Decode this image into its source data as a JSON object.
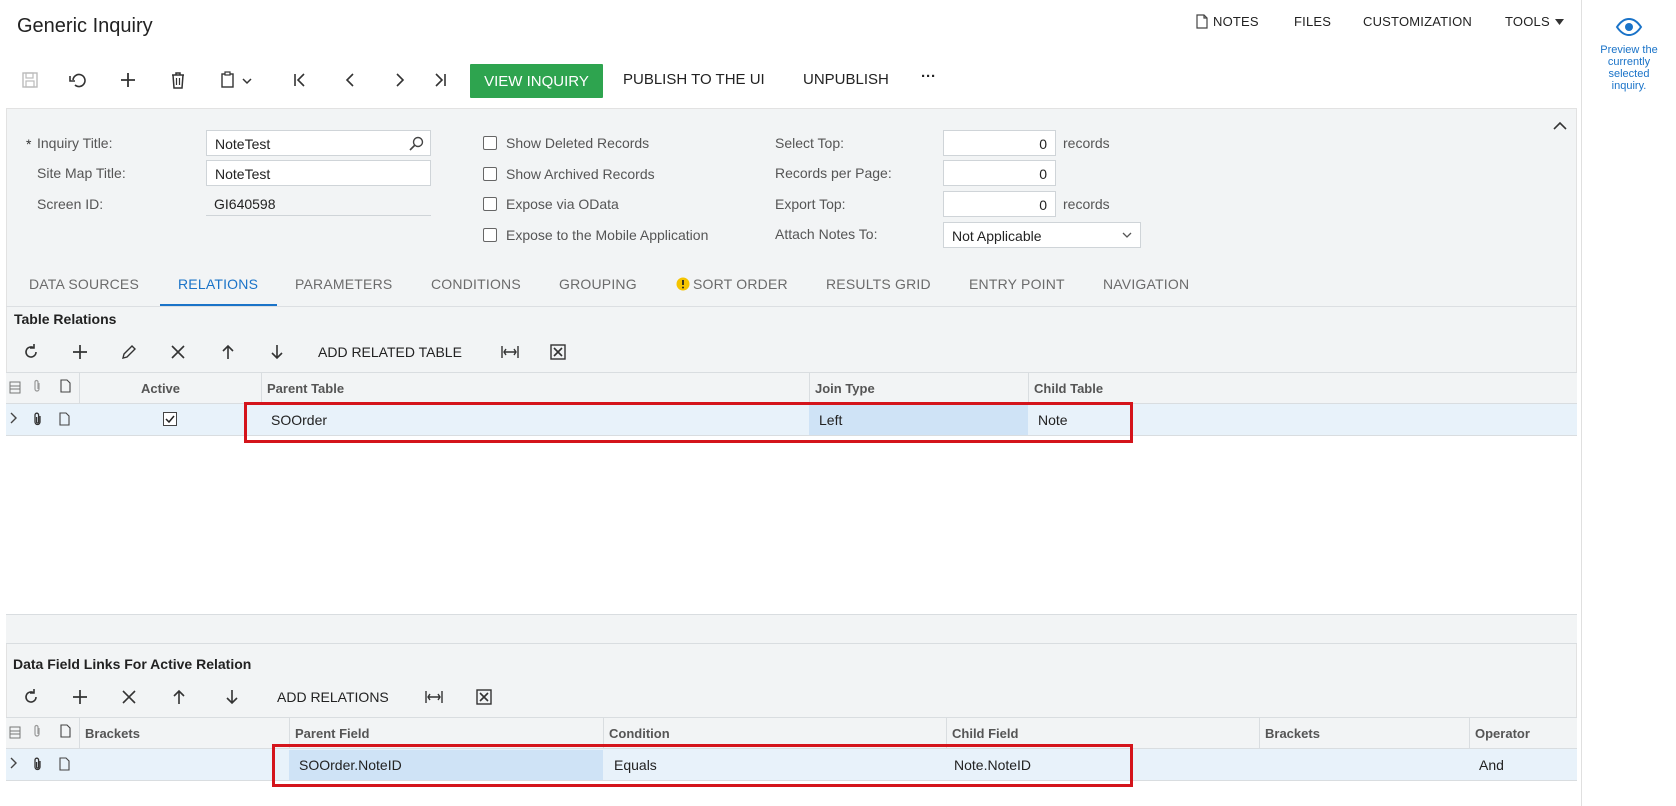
{
  "page": {
    "title": "Generic Inquiry"
  },
  "topmenu": {
    "notes": "NOTES",
    "files": "FILES",
    "customization": "CUSTOMIZATION",
    "tools": "TOOLS"
  },
  "toolbar": {
    "view_inquiry": "VIEW INQUIRY",
    "publish": "PUBLISH TO THE UI",
    "unpublish": "UNPUBLISH",
    "more": "···"
  },
  "right_panel": {
    "preview_text": "Preview the currently selected inquiry."
  },
  "form": {
    "required_marker": "*",
    "inquiry_title_label": "Inquiry Title:",
    "inquiry_title_value": "NoteTest",
    "site_map_title_label": "Site Map Title:",
    "site_map_title_value": "NoteTest",
    "screen_id_label": "Screen ID:",
    "screen_id_value": "GI640598",
    "show_deleted": "Show Deleted Records",
    "show_archived": "Show Archived Records",
    "expose_odata": "Expose via OData",
    "expose_mobile": "Expose to the Mobile Application",
    "select_top_label": "Select Top:",
    "select_top_value": "0",
    "records_per_page_label": "Records per Page:",
    "records_per_page_value": "0",
    "export_top_label": "Export Top:",
    "export_top_value": "0",
    "records_unit": "records",
    "attach_notes_label": "Attach Notes To:",
    "attach_notes_value": "Not Applicable"
  },
  "tabs": [
    {
      "label": "DATA SOURCES"
    },
    {
      "label": "RELATIONS",
      "active": true
    },
    {
      "label": "PARAMETERS"
    },
    {
      "label": "CONDITIONS"
    },
    {
      "label": "GROUPING"
    },
    {
      "label": "SORT ORDER",
      "warning": true
    },
    {
      "label": "RESULTS GRID"
    },
    {
      "label": "ENTRY POINT"
    },
    {
      "label": "NAVIGATION"
    }
  ],
  "table_relations": {
    "title": "Table Relations",
    "add_button": "ADD RELATED TABLE",
    "columns": [
      "Active",
      "Parent Table",
      "Join Type",
      "Child Table"
    ],
    "rows": [
      {
        "active": true,
        "parent_table": "SOOrder",
        "join_type": "Left",
        "child_table": "Note"
      }
    ]
  },
  "data_field_links": {
    "title": "Data Field Links For Active Relation",
    "add_button": "ADD RELATIONS",
    "columns": [
      "Brackets",
      "Parent Field",
      "Condition",
      "Child Field",
      "Brackets",
      "Operator"
    ],
    "rows": [
      {
        "brackets_open": "",
        "parent_field": "SOOrder.NoteID",
        "condition": "Equals",
        "child_field": "Note.NoteID",
        "brackets_close": "",
        "operator": "And"
      }
    ]
  },
  "colors": {
    "accent": "#1a73c8",
    "view_button": "#2ea44f",
    "highlight_border": "#d4141b",
    "row_selected": "#e8f2fa"
  }
}
